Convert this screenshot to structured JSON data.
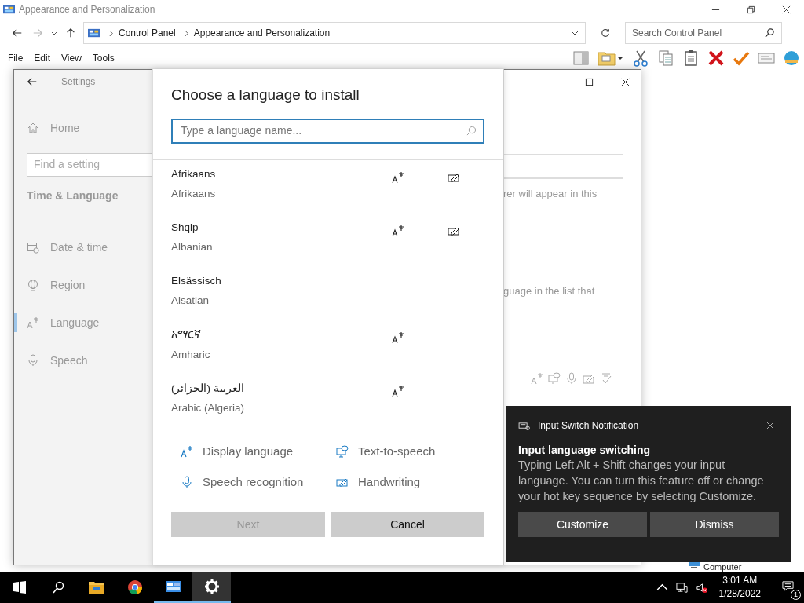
{
  "explorer": {
    "title": "Appearance and Personalization",
    "breadcrumb": [
      "Control Panel",
      "Appearance and Personalization"
    ],
    "search": {
      "placeholder": "Search Control Panel"
    },
    "menu": [
      "File",
      "Edit",
      "View",
      "Tools"
    ],
    "toolbar": [
      {
        "kind": "pane"
      },
      {
        "kind": "folder-menu"
      },
      {
        "kind": "cut"
      },
      {
        "kind": "copy"
      },
      {
        "kind": "paste"
      },
      {
        "kind": "delete"
      },
      {
        "kind": "check"
      },
      {
        "kind": "card"
      },
      {
        "kind": "globe"
      }
    ],
    "item": "Computer"
  },
  "settings": {
    "title": "Settings",
    "home": "Home",
    "search": {
      "placeholder": "Find a setting"
    },
    "section": "Time & Language",
    "nav": [
      {
        "kind": "calendar",
        "label": "Date & time",
        "selected": false
      },
      {
        "kind": "globe",
        "label": "Region",
        "selected": false
      },
      {
        "kind": "language",
        "label": "Language",
        "selected": true
      },
      {
        "kind": "mic",
        "label": "Speech",
        "selected": false
      }
    ],
    "content_fragments": [
      "rer will appear in this",
      "guage in the list that"
    ]
  },
  "dialog": {
    "title": "Choose a language to install",
    "search": {
      "placeholder": "Type a language name..."
    },
    "languages": [
      {
        "native": "Afrikaans",
        "english": "Afrikaans",
        "display": true,
        "handwriting": true
      },
      {
        "native": "Shqip",
        "english": "Albanian",
        "display": true,
        "handwriting": true
      },
      {
        "native": "Elsässisch",
        "english": "Alsatian",
        "display": false,
        "handwriting": false
      },
      {
        "native": "አማርኛ",
        "english": "Amharic",
        "display": true,
        "handwriting": false
      },
      {
        "native": "العربية (الجزائر)",
        "english": "Arabic (Algeria)",
        "display": true,
        "handwriting": false
      }
    ],
    "legend": [
      {
        "kind": "display",
        "label": "Display language"
      },
      {
        "kind": "tts",
        "label": "Text-to-speech"
      },
      {
        "kind": "speech",
        "label": "Speech recognition"
      },
      {
        "kind": "handwriting",
        "label": "Handwriting"
      }
    ],
    "buttons": [
      {
        "label": "Next",
        "disabled": true
      },
      {
        "label": "Cancel",
        "disabled": false
      }
    ]
  },
  "toast": {
    "app": "Input Switch Notification",
    "title": "Input language switching",
    "body": "Typing Left Alt + Shift changes your input language. You can turn this feature off or change your hot key sequence by selecting Customize.",
    "buttons": [
      "Customize",
      "Dismiss"
    ]
  },
  "taskbar": {
    "apps": [
      {
        "kind": "start",
        "running": false,
        "selected": false
      },
      {
        "kind": "search",
        "running": false,
        "selected": false
      },
      {
        "kind": "folder",
        "running": false,
        "selected": false
      },
      {
        "kind": "chrome",
        "running": false,
        "selected": false
      },
      {
        "kind": "control-panel",
        "running": true,
        "selected": false
      },
      {
        "kind": "settings",
        "running": true,
        "selected": true
      }
    ],
    "time": "3:01 AM",
    "date": "1/28/2022",
    "notifications": "1"
  }
}
